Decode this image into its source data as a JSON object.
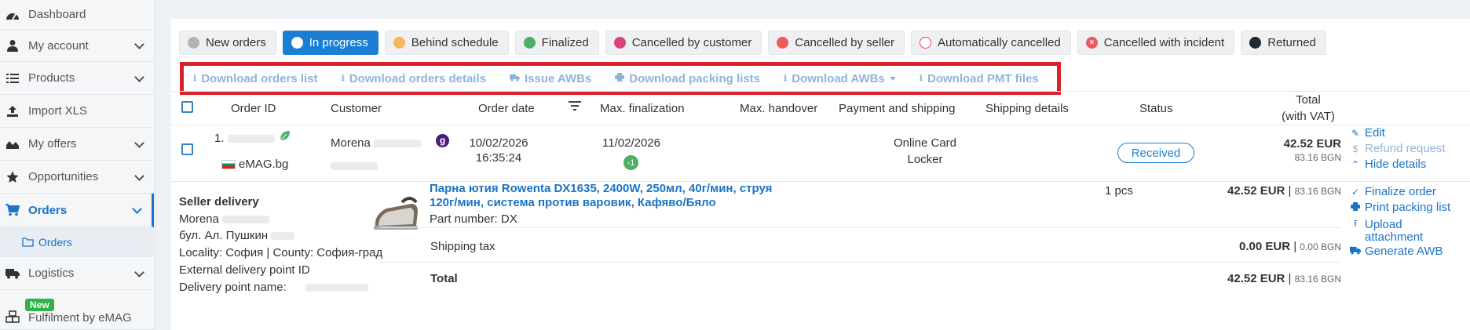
{
  "sidebar": {
    "items": [
      {
        "label": "Dashboard",
        "icon": "dashboard-icon",
        "chevron": false
      },
      {
        "label": "My account",
        "icon": "user-icon",
        "chevron": true
      },
      {
        "label": "Products",
        "icon": "list-icon",
        "chevron": true
      },
      {
        "label": "Import XLS",
        "icon": "upload-icon",
        "chevron": false
      },
      {
        "label": "My offers",
        "icon": "chart-area-icon",
        "chevron": true
      },
      {
        "label": "Opportunities",
        "icon": "star-icon",
        "chevron": true
      },
      {
        "label": "Orders",
        "icon": "cart-icon",
        "chevron": true,
        "active": true
      },
      {
        "label": "Logistics",
        "icon": "truck-icon",
        "chevron": true
      },
      {
        "label": "Fulfilment by eMAG",
        "icon": "boxes-icon",
        "chevron": false
      }
    ],
    "sub_orders_label": "Orders",
    "new_badge": "New"
  },
  "filters": [
    {
      "label": "New orders",
      "color": "#b3b3b3"
    },
    {
      "label": "In progress",
      "color": "#ffffff",
      "active": true
    },
    {
      "label": "Behind schedule",
      "color": "#f6b85a"
    },
    {
      "label": "Finalized",
      "color": "#4caf63"
    },
    {
      "label": "Cancelled by customer",
      "color": "#d8437a"
    },
    {
      "label": "Cancelled by seller",
      "color": "#ec5a5a"
    },
    {
      "label": "Automatically cancelled",
      "color": "outline-red"
    },
    {
      "label": "Cancelled with incident",
      "color": "x-red"
    },
    {
      "label": "Returned",
      "color": "#1f2a33"
    }
  ],
  "downloads": [
    {
      "label": "Download orders list",
      "icon": "download-icon"
    },
    {
      "label": "Download orders details",
      "icon": "download-icon"
    },
    {
      "label": "Issue AWBs",
      "icon": "truck-icon"
    },
    {
      "label": "Download packing lists",
      "icon": "print-icon"
    },
    {
      "label": "Download AWBs",
      "icon": "download-icon",
      "dropdown": true
    },
    {
      "label": "Download PMT files",
      "icon": "download-icon"
    }
  ],
  "table": {
    "headers": {
      "order_id": "Order ID",
      "customer": "Customer",
      "order_date": "Order date",
      "max_finalization": "Max. finalization",
      "max_handover": "Max. handover",
      "payment_shipping": "Payment and shipping",
      "shipping_details": "Shipping details",
      "status": "Status",
      "total_line1": "Total",
      "total_line2": "(with VAT)"
    }
  },
  "order": {
    "id_prefix": "1.",
    "marketplace": "eMAG.bg",
    "customer_name": "Morena",
    "date": "10/02/2026",
    "time": "16:35:24",
    "max_finalization": "11/02/2026",
    "finalization_badge": "-1",
    "payment_line1": "Online Card",
    "payment_line2": "Locker",
    "status": "Received",
    "total_eur": "42.52 EUR",
    "total_bgn": "83.16 BGN",
    "actions": {
      "edit": "Edit",
      "refund": "Refund request",
      "hide": "Hide details"
    }
  },
  "details": {
    "delivery_title": "Seller delivery",
    "delivery_name": "Morena",
    "delivery_street": "бул. Ал. Пушкин",
    "delivery_locality": "Locality: София | County: София-град",
    "delivery_external": "External delivery point ID",
    "delivery_point_name": "Delivery point name:",
    "product_title": "Парна ютия Rowenta DX1635, 2400W, 250мл, 40г/мин, струя 120г/мин, система против варовик, Кафяво/Бяло",
    "part_number": "Part number: DX",
    "qty": "1 pcs",
    "line_eur": "42.52 EUR",
    "line_bgn": "83.16 BGN",
    "shipping_label": "Shipping tax",
    "shipping_eur": "0.00 EUR",
    "shipping_bgn": "0.00 BGN",
    "total_label": "Total",
    "total_eur": "42.52 EUR",
    "total_bgn": "83.16 BGN",
    "actions": {
      "finalize": "Finalize order",
      "print": "Print packing list",
      "upload_line1": "Upload",
      "upload_line2": "attachment",
      "awb": "Generate AWB"
    }
  }
}
